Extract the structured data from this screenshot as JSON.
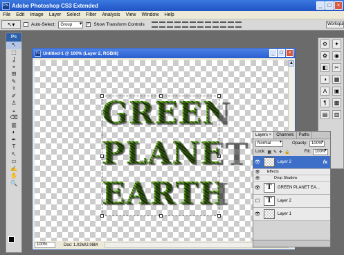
{
  "app": {
    "title": "Adobe Photoshop CS3 Extended",
    "logo": "Ps"
  },
  "window_controls": {
    "minimize": "_",
    "maximize": "□",
    "close": "×"
  },
  "menu": [
    "File",
    "Edit",
    "Image",
    "Layer",
    "Select",
    "Filter",
    "Analysis",
    "View",
    "Window",
    "Help"
  ],
  "options_bar": {
    "auto_select_label": "Auto-Select:",
    "auto_select_value": "Group",
    "show_transform_label": "Show Transform Controls",
    "show_transform_checked": "✓",
    "workspace_label": "Workspace"
  },
  "toolbox": {
    "logo": "Ps",
    "tools": [
      "↖",
      "⬚",
      "ʆ",
      "⌖",
      "⊞",
      "✎",
      "⚕",
      "✐",
      "♙",
      "◒",
      "⌫",
      "▥",
      "◐",
      "✒",
      "T",
      "↖",
      "▭",
      "✍",
      "✋",
      "🔍"
    ]
  },
  "document": {
    "title": "Untitled-1 @ 100% (Layer 2, RGB/8)",
    "lines": [
      "GREEN",
      "PLANET",
      "EARTH"
    ],
    "zoom": "100%",
    "doc_info": "Doc: 1.02M/2.08M"
  },
  "dock": {
    "col1": [
      "⚙",
      "✿",
      "◧",
      "◑",
      "A",
      "¶",
      "▤"
    ],
    "col2": [
      "✦",
      "◉",
      "✂",
      "▦",
      "▣",
      "▩",
      "▥"
    ]
  },
  "layers_panel": {
    "tabs": [
      "Layers",
      "Channels",
      "Paths"
    ],
    "tab_close": "×",
    "blend_mode": "Normal",
    "opacity_label": "Opacity:",
    "opacity_value": "100%",
    "lock_label": "Lock:",
    "fill_label": "Fill:",
    "fill_value": "100%",
    "layers": [
      {
        "name": "Layer 2",
        "fx": "fx",
        "eye": "👁"
      },
      {
        "name": "GREEN   PLANET   EA...",
        "eye": "👁",
        "thumb": "T"
      },
      {
        "name": "Layer 2",
        "thumb": "T"
      },
      {
        "name": "Layer 1",
        "eye": "👁"
      }
    ],
    "effects_label": "Effects",
    "drop_shadow_label": "Drop Shadow"
  }
}
